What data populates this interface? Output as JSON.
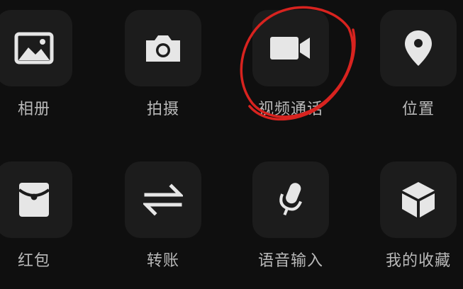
{
  "accent_annotation_color": "#d8231f",
  "items": [
    {
      "label": "相册",
      "icon": "photo-album-icon"
    },
    {
      "label": "拍摄",
      "icon": "camera-icon"
    },
    {
      "label": "视频通话",
      "icon": "video-call-icon"
    },
    {
      "label": "位置",
      "icon": "location-pin-icon"
    },
    {
      "label": "红包",
      "icon": "red-packet-icon"
    },
    {
      "label": "转账",
      "icon": "transfer-icon"
    },
    {
      "label": "语音输入",
      "icon": "microphone-icon"
    },
    {
      "label": "我的收藏",
      "icon": "favorites-cube-icon"
    }
  ]
}
